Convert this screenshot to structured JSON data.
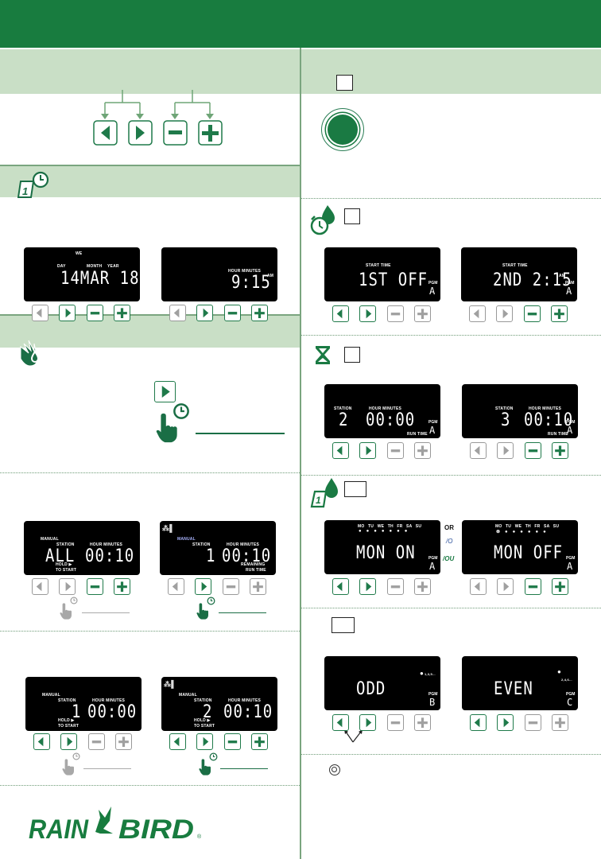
{
  "colors": {
    "brand_green": "#187c3f",
    "light_band": "#c9dfc6",
    "button_active": "#1f7a4a",
    "button_inactive": "#a0a0a0"
  },
  "logo": {
    "text": "RAIN BIRD",
    "registered": "®"
  },
  "icons": {
    "date_time": "calendar-clock-icon",
    "manual": "hand-water-icon",
    "start_time": "alarm-clock-drop-icon",
    "run_time": "hourglass-icon",
    "water_days": "calendar-drop-icon",
    "odd_even": "none",
    "power": "round-button-icon"
  },
  "or_labels": {
    "en": "OR",
    "fr": "/O",
    "es": "/OU"
  },
  "displays": {
    "date": {
      "weekday": "WE",
      "day": "DAY",
      "month": "MONTH",
      "year": "YEAR",
      "value": "14MAR 18",
      "buttons": [
        "inactive",
        "active",
        "active",
        "active"
      ]
    },
    "time": {
      "hm": "HOUR MINUTES",
      "value": "9:15",
      "ampm": "AM",
      "buttons": [
        "inactive",
        "active",
        "active",
        "active"
      ]
    },
    "manual_all": {
      "manual": "MANUAL",
      "station": "STATION",
      "hm": "HOUR MINUTES",
      "st_value": "ALL",
      "value": "00:10",
      "hold": "HOLD ▶",
      "to_start": "TO START",
      "buttons": [
        "inactive",
        "inactive",
        "active",
        "active"
      ]
    },
    "manual_run": {
      "manual": "MANUAL",
      "station": "STATION",
      "hm": "HOUR MINUTES",
      "st_value": "1",
      "value": "00:10",
      "rem": "REMAINING",
      "run": "RUN TIME",
      "buttons": [
        "inactive",
        "active",
        "inactive",
        "inactive"
      ]
    },
    "manual_st1": {
      "manual": "MANUAL",
      "station": "STATION",
      "hm": "HOUR MINUTES",
      "st_value": "1",
      "value": "00:00",
      "hold": "HOLD ▶",
      "to_start": "TO START",
      "buttons": [
        "active",
        "active",
        "inactive",
        "inactive"
      ]
    },
    "manual_st2": {
      "manual": "MANUAL",
      "station": "STATION",
      "hm": "HOUR MINUTES",
      "st_value": "2",
      "value": "00:10",
      "hold": "HOLD ▶",
      "to_start": "TO START",
      "buttons": [
        "active",
        "active",
        "active",
        "active"
      ]
    },
    "start1": {
      "label": "START TIME",
      "value": "1ST  OFF",
      "pgm": "PGM",
      "pgm_value": "A",
      "buttons": [
        "active",
        "active",
        "inactive",
        "inactive"
      ]
    },
    "start2": {
      "label": "START TIME",
      "value": "2ND  2:15",
      "ampm": "AM",
      "pgm": "PGM",
      "pgm_value": "A",
      "buttons": [
        "inactive",
        "inactive",
        "active",
        "active"
      ]
    },
    "run2": {
      "station": "STATION",
      "hm": "HOUR MINUTES",
      "st_value": "2",
      "value": "00:00",
      "run": "RUN TIME",
      "pgm": "PGM",
      "pgm_value": "A",
      "buttons": [
        "active",
        "active",
        "inactive",
        "inactive"
      ]
    },
    "run3": {
      "station": "STATION",
      "hm": "HOUR MINUTES",
      "st_value": "3",
      "value": "00:10",
      "run": "RUN TIME",
      "pgm": "PGM",
      "pgm_value": "A",
      "buttons": [
        "inactive",
        "inactive",
        "active",
        "active"
      ]
    },
    "day_on": {
      "days": "MO TU WE TH FR SA SU",
      "value": "MON  ON",
      "pgm": "PGM",
      "pgm_value": "A",
      "buttons": [
        "active",
        "active",
        "inactive",
        "inactive"
      ]
    },
    "day_off": {
      "days": "MO TU WE TH FR SA SU",
      "value": "MON  OFF",
      "pgm": "PGM",
      "pgm_value": "A",
      "buttons": [
        "inactive",
        "inactive",
        "active",
        "active"
      ]
    },
    "odd": {
      "value": "ODD",
      "seq": "1,3,5...",
      "pgm": "PGM",
      "pgm_value": "B",
      "buttons": [
        "active",
        "active",
        "inactive",
        "inactive"
      ]
    },
    "even": {
      "value": "EVEN",
      "seq": "2,4,6...",
      "pgm": "PGM",
      "pgm_value": "C",
      "buttons": [
        "active",
        "active",
        "inactive",
        "inactive"
      ]
    }
  }
}
